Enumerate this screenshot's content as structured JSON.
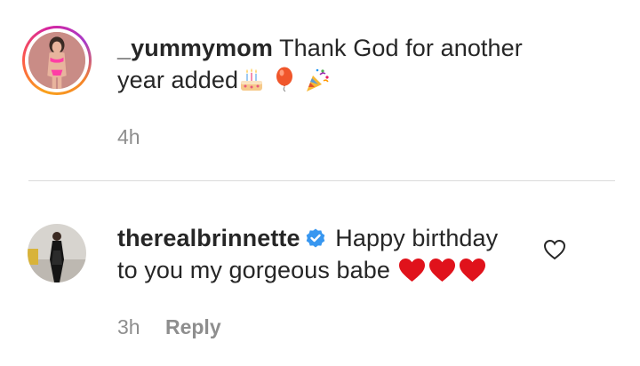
{
  "comments": [
    {
      "username": "_yummymom",
      "text_line1": "Thank God for another",
      "text_line2": "year added",
      "emojis": [
        "birthday-cake-icon",
        "balloon-icon",
        "party-popper-icon"
      ],
      "time": "4h",
      "has_story_ring": true
    },
    {
      "username": "therealbrinnette",
      "verified": true,
      "text_line1": "Happy birthday",
      "text_line2": "to you my gorgeous babe",
      "emojis": [
        "red-heart-icon",
        "red-heart-icon",
        "red-heart-icon"
      ],
      "time": "3h",
      "reply_label": "Reply"
    }
  ],
  "colors": {
    "text": "#262626",
    "muted": "#8e8e8e",
    "verified": "#3897f0",
    "heart": "#e0121b",
    "divider": "#dbdbdb"
  }
}
